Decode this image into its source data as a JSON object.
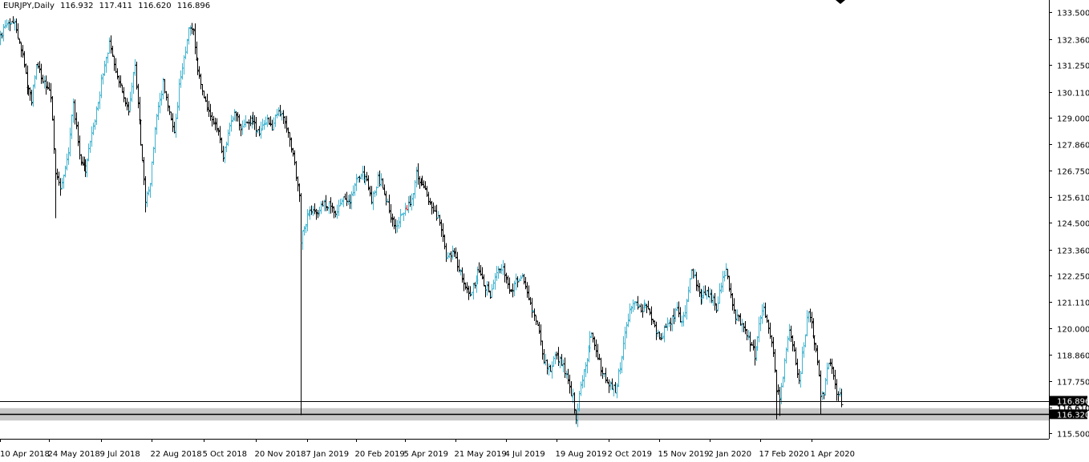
{
  "header": {
    "symbol": "EURJPY,Daily",
    "open": "116.932",
    "high": "117.411",
    "low": "116.620",
    "close": "116.896"
  },
  "colors": {
    "bull": "#40b4d0",
    "bear": "#000000",
    "background": "#ffffff",
    "zone": "#c8c8c8",
    "price_tag_bg": "#000000",
    "price_tag_fg": "#ffffff",
    "highlight": "#d03030"
  },
  "chart_data": {
    "type": "bar",
    "subtype": "ohlc",
    "title": "EURJPY,Daily",
    "y_ticks": [
      "133.500",
      "132.360",
      "131.250",
      "130.110",
      "129.000",
      "127.860",
      "126.750",
      "125.610",
      "124.500",
      "123.360",
      "122.250",
      "121.110",
      "120.000",
      "118.860",
      "117.750",
      "116.610",
      "115.500"
    ],
    "ylim": [
      115.27,
      134.03
    ],
    "x_ticks": [
      "10 Apr 2018",
      "24 May 2018",
      "9 Jul 2018",
      "22 Aug 2018",
      "5 Oct 2018",
      "20 Nov 2018",
      "7 Jan 2019",
      "20 Feb 2019",
      "5 Apr 2019",
      "21 May 2019",
      "4 Jul 2019",
      "19 Aug 2019",
      "2 Oct 2019",
      "15 Nov 2019",
      "2 Jan 2020",
      "17 Feb 2020",
      "1 Apr 2020"
    ],
    "current_price": "116.896",
    "current_price_value": 116.896,
    "support_zone": {
      "low": 116.05,
      "high": 116.58
    },
    "support_line": 116.32,
    "support_label": "116.320",
    "hidden_tag": "116.610",
    "anchors": [
      [
        0,
        132.4
      ],
      [
        4,
        133.0
      ],
      [
        9,
        133.2
      ],
      [
        14,
        131.6
      ],
      [
        17,
        130.4
      ],
      [
        20,
        129.8
      ],
      [
        23,
        131.2
      ],
      [
        27,
        130.7
      ],
      [
        32,
        129.9
      ],
      [
        35,
        126.7
      ],
      [
        38,
        126.0
      ],
      [
        43,
        127.5
      ],
      [
        46,
        129.7
      ],
      [
        50,
        127.3
      ],
      [
        54,
        126.8
      ],
      [
        59,
        128.6
      ],
      [
        64,
        130.5
      ],
      [
        69,
        132.2
      ],
      [
        73,
        131.1
      ],
      [
        77,
        130.0
      ],
      [
        81,
        129.4
      ],
      [
        85,
        131.2
      ],
      [
        89,
        128.0
      ],
      [
        92,
        125.5
      ],
      [
        95,
        126.3
      ],
      [
        99,
        129.2
      ],
      [
        103,
        130.4
      ],
      [
        107,
        129.4
      ],
      [
        110,
        128.4
      ],
      [
        114,
        130.9
      ],
      [
        117,
        131.9
      ],
      [
        119,
        133.0
      ],
      [
        122,
        132.6
      ],
      [
        126,
        130.7
      ],
      [
        130,
        129.7
      ],
      [
        134,
        128.9
      ],
      [
        138,
        128.4
      ],
      [
        141,
        127.3
      ],
      [
        144,
        128.2
      ],
      [
        148,
        129.4
      ],
      [
        152,
        128.6
      ],
      [
        156,
        128.8
      ],
      [
        160,
        129.0
      ],
      [
        164,
        128.2
      ],
      [
        168,
        128.9
      ],
      [
        172,
        128.6
      ],
      [
        176,
        129.3
      ],
      [
        180,
        128.7
      ],
      [
        184,
        127.7
      ],
      [
        187,
        126.6
      ],
      [
        189,
        125.6
      ],
      [
        190,
        123.7
      ],
      [
        192,
        124.4
      ],
      [
        196,
        125.1
      ],
      [
        200,
        124.8
      ],
      [
        204,
        125.4
      ],
      [
        208,
        125.2
      ],
      [
        212,
        124.9
      ],
      [
        216,
        125.6
      ],
      [
        220,
        125.3
      ],
      [
        224,
        126.1
      ],
      [
        228,
        126.7
      ],
      [
        232,
        126.3
      ],
      [
        235,
        125.4
      ],
      [
        239,
        126.4
      ],
      [
        242,
        126.1
      ],
      [
        246,
        125.0
      ],
      [
        250,
        124.3
      ],
      [
        253,
        124.8
      ],
      [
        256,
        125.2
      ],
      [
        260,
        125.4
      ],
      [
        263,
        126.6
      ],
      [
        266,
        126.3
      ],
      [
        270,
        125.7
      ],
      [
        274,
        125.0
      ],
      [
        278,
        124.6
      ],
      [
        282,
        123.1
      ],
      [
        286,
        123.2
      ],
      [
        290,
        122.6
      ],
      [
        294,
        121.8
      ],
      [
        298,
        121.5
      ],
      [
        302,
        122.4
      ],
      [
        306,
        121.9
      ],
      [
        310,
        121.4
      ],
      [
        314,
        122.3
      ],
      [
        318,
        122.5
      ],
      [
        322,
        121.5
      ],
      [
        326,
        121.9
      ],
      [
        330,
        122.1
      ],
      [
        334,
        121.2
      ],
      [
        338,
        120.6
      ],
      [
        341,
        119.9
      ],
      [
        344,
        118.6
      ],
      [
        348,
        118.3
      ],
      [
        352,
        118.8
      ],
      [
        356,
        118.4
      ],
      [
        359,
        117.8
      ],
      [
        362,
        117.0
      ],
      [
        364,
        116.2
      ],
      [
        367,
        117.6
      ],
      [
        371,
        118.7
      ],
      [
        374,
        119.8
      ],
      [
        378,
        118.8
      ],
      [
        382,
        117.9
      ],
      [
        386,
        117.6
      ],
      [
        389,
        117.3
      ],
      [
        392,
        118.4
      ],
      [
        395,
        119.8
      ],
      [
        398,
        120.7
      ],
      [
        401,
        121.1
      ],
      [
        405,
        120.8
      ],
      [
        408,
        121.0
      ],
      [
        412,
        120.5
      ],
      [
        415,
        119.9
      ],
      [
        418,
        119.6
      ],
      [
        421,
        120.2
      ],
      [
        425,
        120.4
      ],
      [
        428,
        120.8
      ],
      [
        431,
        120.2
      ],
      [
        434,
        121.1
      ],
      [
        437,
        122.6
      ],
      [
        440,
        121.9
      ],
      [
        443,
        121.2
      ],
      [
        446,
        121.6
      ],
      [
        450,
        121.3
      ],
      [
        453,
        120.9
      ],
      [
        456,
        121.9
      ],
      [
        459,
        122.6
      ],
      [
        462,
        121.4
      ],
      [
        465,
        120.4
      ],
      [
        468,
        120.3
      ],
      [
        471,
        119.9
      ],
      [
        474,
        119.4
      ],
      [
        477,
        118.8
      ],
      [
        480,
        120.1
      ],
      [
        483,
        120.8
      ],
      [
        486,
        119.9
      ],
      [
        489,
        118.9
      ],
      [
        491,
        117.4
      ],
      [
        493,
        116.9
      ],
      [
        496,
        118.5
      ],
      [
        499,
        120.0
      ],
      [
        502,
        119.0
      ],
      [
        505,
        117.7
      ],
      [
        508,
        119.3
      ],
      [
        511,
        120.8
      ],
      [
        514,
        119.8
      ],
      [
        517,
        118.5
      ],
      [
        519,
        117.2
      ],
      [
        521,
        117.1
      ],
      [
        523,
        118.2
      ],
      [
        525,
        118.5
      ],
      [
        527,
        118.0
      ],
      [
        529,
        117.3
      ],
      [
        531,
        117.1
      ],
      [
        532,
        116.9
      ]
    ]
  }
}
